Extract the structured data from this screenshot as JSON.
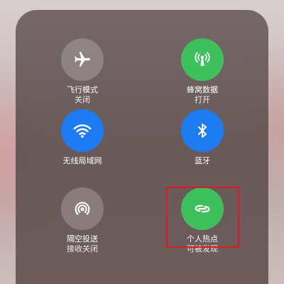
{
  "tiles": [
    {
      "id": "airplane",
      "label": "飞行模式",
      "status": "关闭",
      "icon": "airplane-icon",
      "color": "#c8bebe"
    },
    {
      "id": "cellular",
      "label": "蜂窝数据",
      "status": "打开",
      "icon": "cellular-antenna-icon",
      "color": "#3ec15d"
    },
    {
      "id": "wifi",
      "label": "无线局域网",
      "status": "",
      "icon": "wifi-icon",
      "color": "#1d7cf2"
    },
    {
      "id": "bluetooth",
      "label": "蓝牙",
      "status": "",
      "icon": "bluetooth-icon",
      "color": "#1d7cf2"
    },
    {
      "id": "airdrop",
      "label": "隔空投送",
      "status": "接收关闭",
      "icon": "airdrop-icon",
      "color": "#c8bebe"
    },
    {
      "id": "hotspot",
      "label": "个人热点",
      "status": "可被发现",
      "icon": "hotspot-link-icon",
      "color": "#3ec15d"
    }
  ],
  "highlight_color": "#e01a1a"
}
